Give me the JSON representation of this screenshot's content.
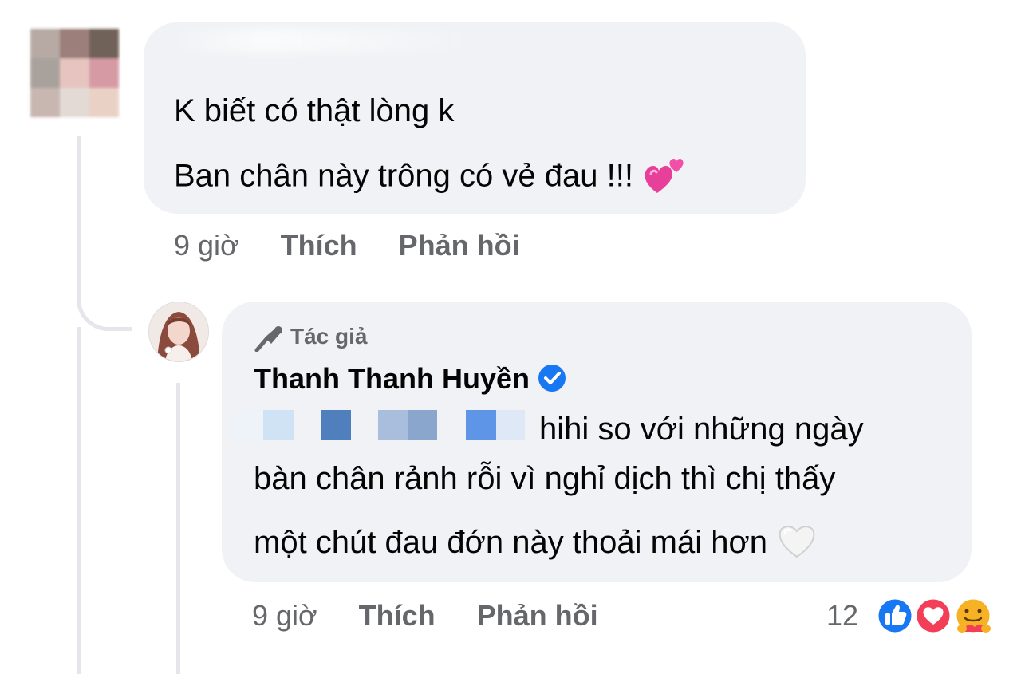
{
  "comment1": {
    "line1": "K biết có thật lòng k",
    "line2": "Ban chân này trông có vẻ đau !!!",
    "emoji_icon": "two-hearts-icon",
    "time": "9 giờ",
    "like_label": "Thích",
    "reply_label": "Phản hồi"
  },
  "comment2": {
    "author_tag_label": "Tác giả",
    "author_tag_icon": "microphone-icon",
    "author_name": "Thanh Thanh Huyền",
    "verified_icon": "verified-badge-icon",
    "line1": "hihi so với những ngày",
    "line2": "bàn chân rảnh rỗi vì nghỉ dịch thì chị thấy",
    "line3": "một chút đau đớn này thoải mái hơn",
    "emoji_icon": "white-heart-icon",
    "time": "9 giờ",
    "like_label": "Thích",
    "reply_label": "Phản hồi",
    "reaction_count": "12",
    "reaction_icons": [
      "like-icon",
      "love-icon",
      "care-icon"
    ]
  },
  "colors": {
    "bubble": "#f0f2f5",
    "meta_text": "#65676b",
    "like_blue": "#1877f2",
    "love_red": "#f33e58",
    "care_yellow": "#f7b125"
  }
}
